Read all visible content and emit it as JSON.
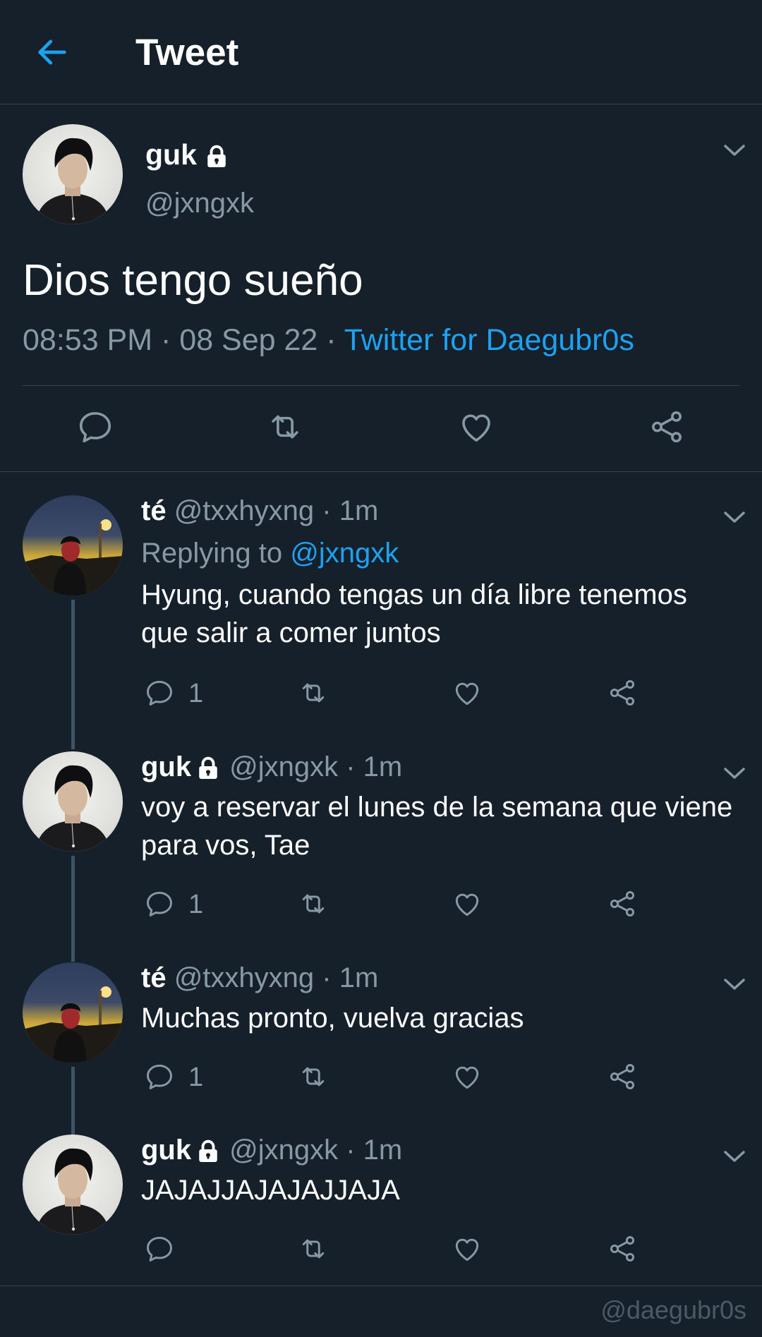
{
  "header": {
    "title": "Tweet"
  },
  "main_tweet": {
    "name": "guk",
    "handle": "@jxngxk",
    "text": "Dios tengo sueño",
    "time": "08:53 PM",
    "date": "08 Sep 22",
    "source": "Twitter for Daegubr0s"
  },
  "replies": [
    {
      "name": "té",
      "handle": "@txxhyxng",
      "time": "1m",
      "replying_label": "Replying to ",
      "replying_to": "@jxngxk",
      "text": "Hyung, cuando tengas un día libre tenemos que salir a comer juntos",
      "reply_count": "1"
    },
    {
      "name": "guk",
      "handle": "@jxngxk",
      "time": "1m",
      "text": "voy a reservar el lunes de la semana que viene para vos, Tae",
      "reply_count": "1"
    },
    {
      "name": "té",
      "handle": "@txxhyxng",
      "time": "1m",
      "text": "Muchas pronto, vuelva gracias",
      "reply_count": "1"
    },
    {
      "name": "guk",
      "handle": "@jxngxk",
      "time": "1m",
      "text": "JAJAJJAJAJAJJAJA",
      "reply_count": ""
    }
  ],
  "watermark": "@daegubr0s",
  "colors": {
    "background": "#15202b",
    "accent": "#1da1f2",
    "muted": "#8899a6",
    "border": "#38444d"
  }
}
